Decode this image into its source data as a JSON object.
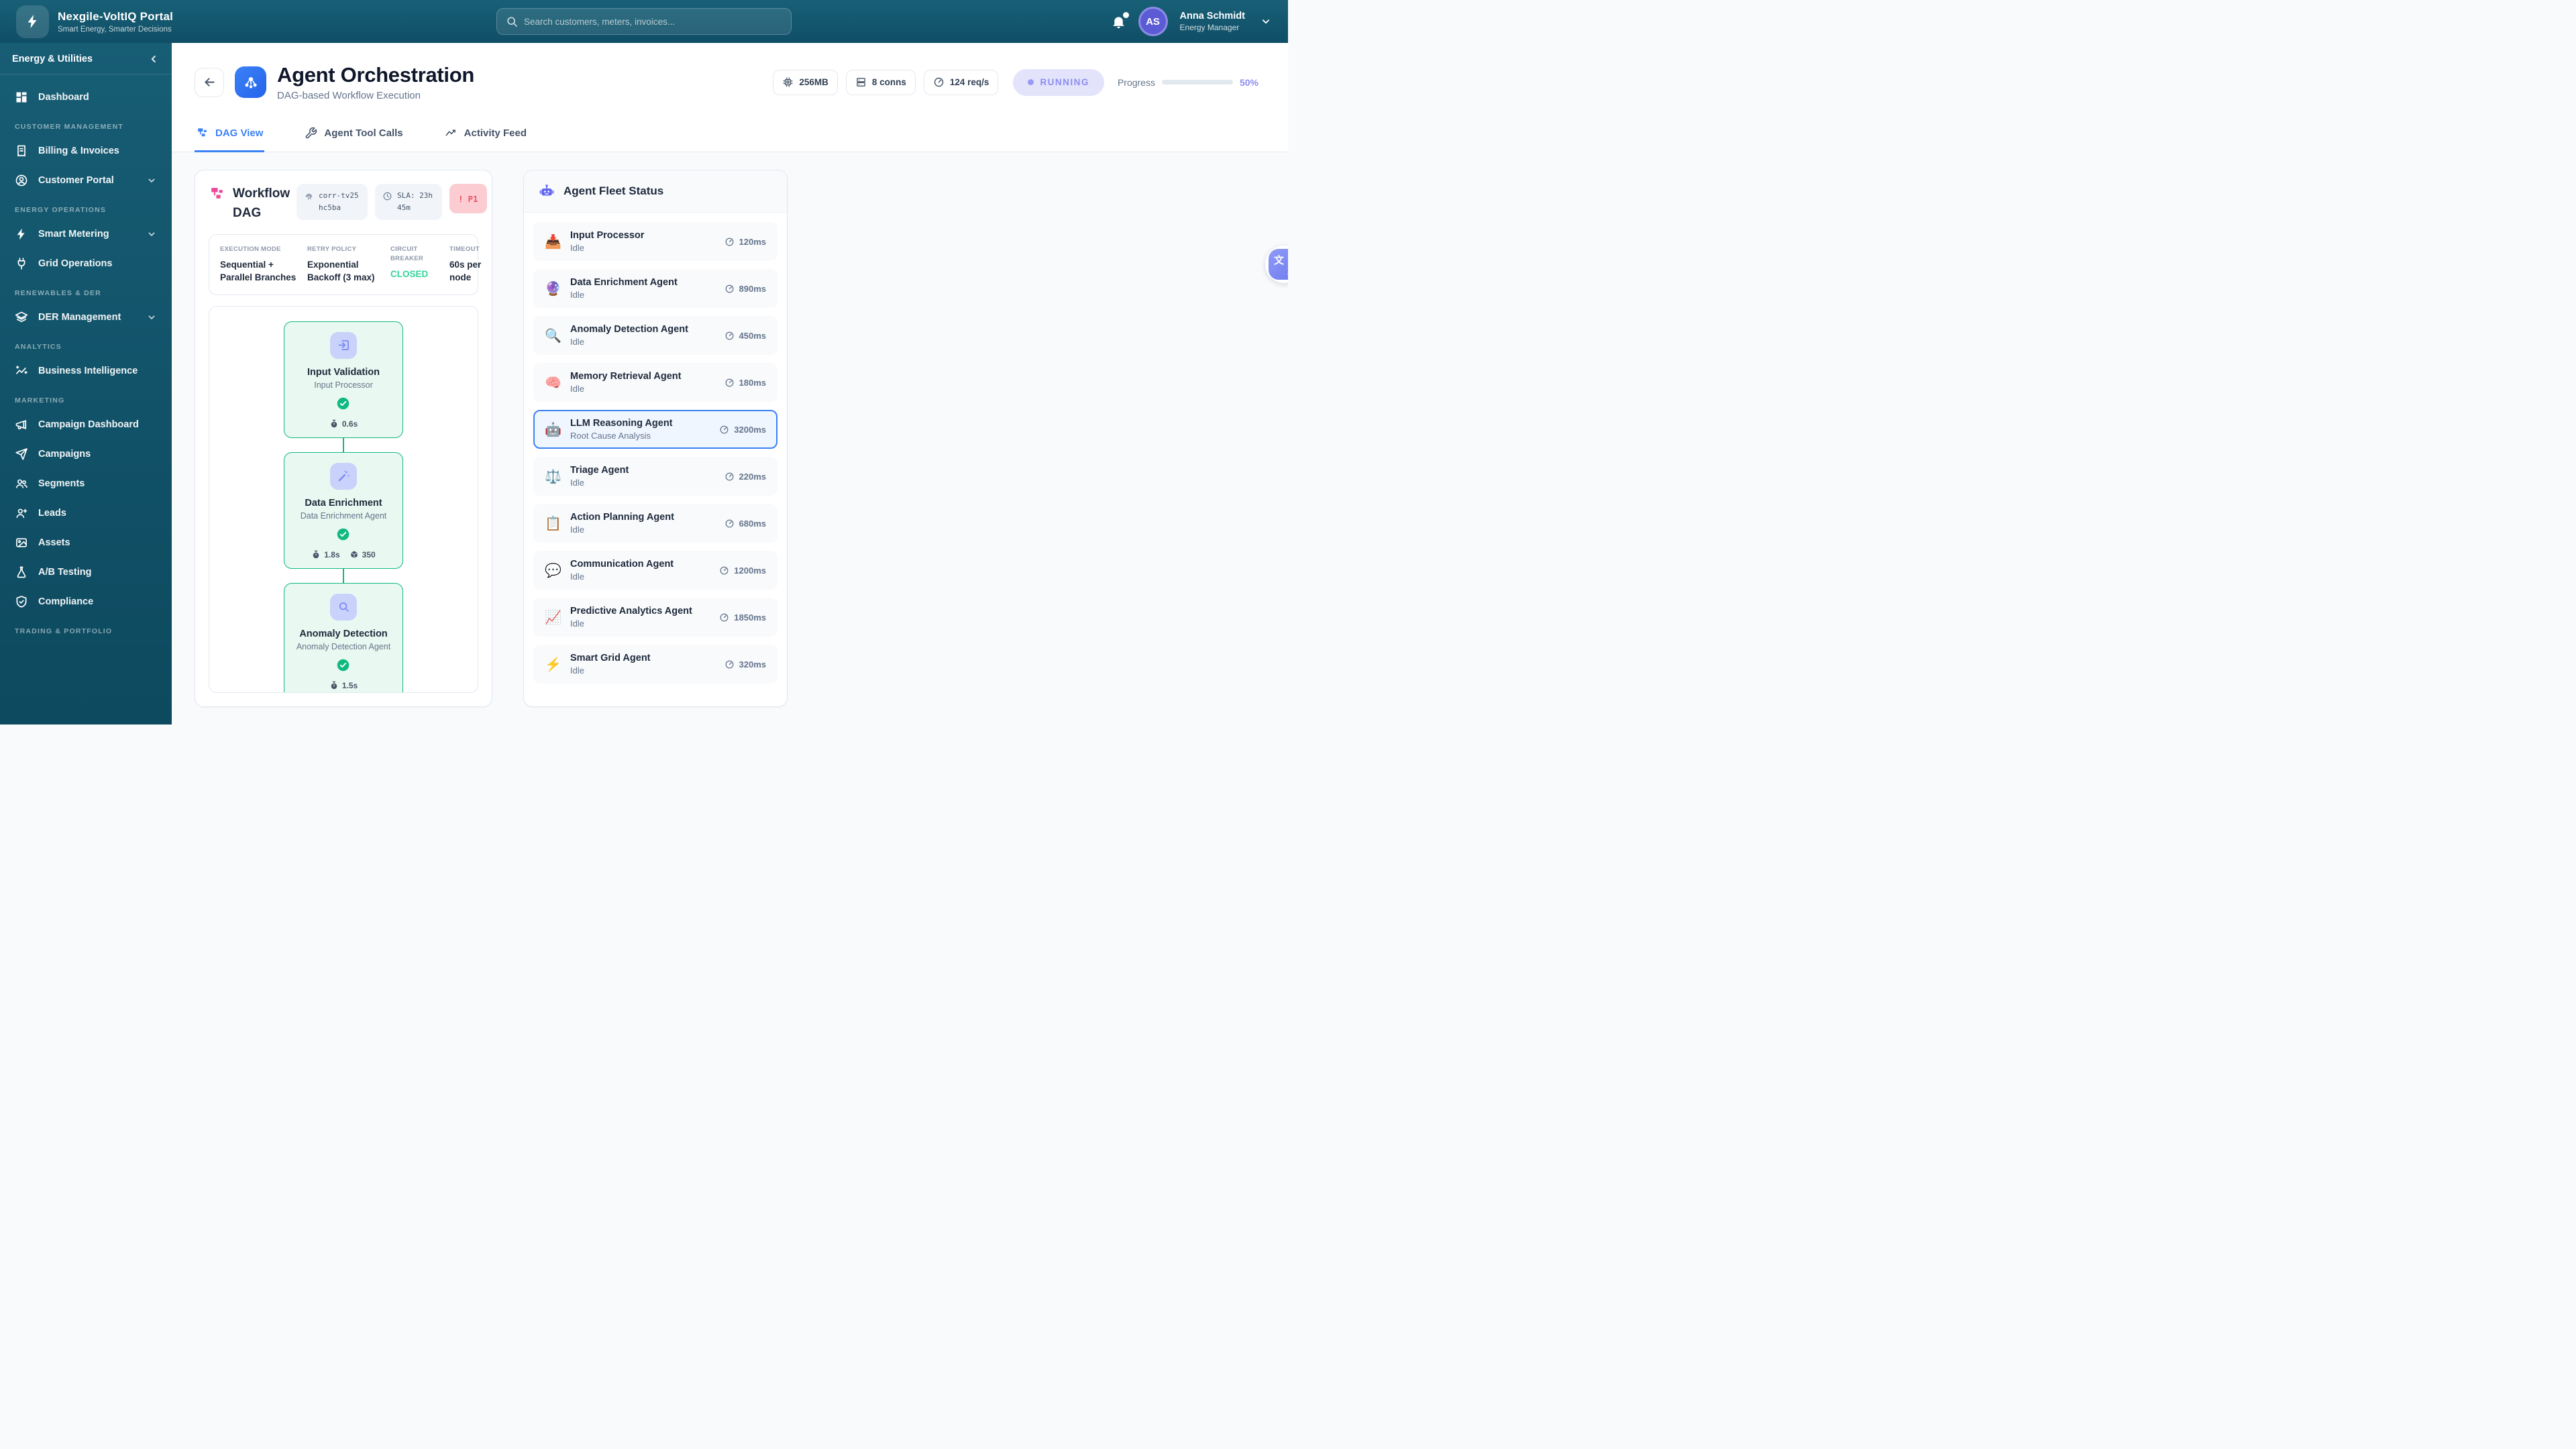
{
  "header": {
    "app_title": "Nexgile-VoltIQ Portal",
    "app_subtitle": "Smart Energy, Smarter Decisions",
    "search_placeholder": "Search customers, meters, invoices...",
    "user_initials": "AS",
    "user_name": "Anna Schmidt",
    "user_role": "Energy Manager"
  },
  "sidebar": {
    "context_label": "Energy & Utilities",
    "sections": [
      {
        "label": "",
        "items": [
          {
            "label": "Dashboard",
            "icon": "grid-icon"
          }
        ]
      },
      {
        "label": "CUSTOMER MANAGEMENT",
        "items": [
          {
            "label": "Billing & Invoices",
            "icon": "receipt-icon"
          },
          {
            "label": "Customer Portal",
            "icon": "person-circle-icon",
            "expandable": true
          }
        ]
      },
      {
        "label": "ENERGY OPERATIONS",
        "items": [
          {
            "label": "Smart Metering",
            "icon": "bolt-icon",
            "expandable": true
          },
          {
            "label": "Grid Operations",
            "icon": "plug-icon"
          }
        ]
      },
      {
        "label": "RENEWABLES & DER",
        "items": [
          {
            "label": "DER Management",
            "icon": "layers-icon",
            "expandable": true
          }
        ]
      },
      {
        "label": "ANALYTICS",
        "items": [
          {
            "label": "Business Intelligence",
            "icon": "sparkline-icon"
          }
        ]
      },
      {
        "label": "MARKETING",
        "items": [
          {
            "label": "Campaign Dashboard",
            "icon": "megaphone-icon"
          },
          {
            "label": "Campaigns",
            "icon": "send-icon"
          },
          {
            "label": "Segments",
            "icon": "people-icon"
          },
          {
            "label": "Leads",
            "icon": "person-add-icon"
          },
          {
            "label": "Assets",
            "icon": "image-icon"
          },
          {
            "label": "A/B Testing",
            "icon": "flask-icon"
          },
          {
            "label": "Compliance",
            "icon": "shield-check-icon"
          }
        ]
      },
      {
        "label": "TRADING & PORTFOLIO",
        "items": []
      }
    ]
  },
  "page": {
    "title": "Agent Orchestration",
    "subtitle": "DAG-based Workflow Execution",
    "stats": [
      {
        "icon": "cpu-icon",
        "label": "256MB"
      },
      {
        "icon": "server-icon",
        "label": "8 conns"
      },
      {
        "icon": "gauge-icon",
        "label": "124 req/s"
      }
    ],
    "status_label": "RUNNING",
    "progress_label": "Progress",
    "progress_value": 50,
    "progress_pct": "50%"
  },
  "tabs": [
    {
      "label": "DAG View",
      "icon": "dag-icon",
      "active": true
    },
    {
      "label": "Agent Tool Calls",
      "icon": "wrench-icon",
      "active": false
    },
    {
      "label": "Activity Feed",
      "icon": "activity-icon",
      "active": false
    }
  ],
  "workflow": {
    "title": "Workflow DAG",
    "correlation_id": "corr-tv25hc5ba",
    "sla": "SLA: 23h 45m",
    "priority": "P1",
    "priority_bang": "!",
    "exec": [
      {
        "label": "EXECUTION MODE",
        "value": "Sequential + Parallel Branches",
        "highlight": false
      },
      {
        "label": "RETRY POLICY",
        "value": "Exponential Backoff (3 max)",
        "highlight": false
      },
      {
        "label": "CIRCUIT BREAKER",
        "value": "CLOSED",
        "highlight": true
      },
      {
        "label": "TIMEOUT",
        "value": "60s per node",
        "highlight": false
      }
    ],
    "nodes": [
      {
        "title": "Input Validation",
        "subtitle": "Input Processor",
        "icon": "enter-icon",
        "duration": "0.6s",
        "tokens": ""
      },
      {
        "title": "Data Enrichment",
        "subtitle": "Data Enrichment Agent",
        "icon": "wand-icon",
        "duration": "1.8s",
        "tokens": "350"
      },
      {
        "title": "Anomaly Detection",
        "subtitle": "Anomaly Detection Agent",
        "icon": "search-icon",
        "duration": "1.5s",
        "tokens": ""
      }
    ],
    "branch_nodes": [
      {
        "icon": "cpu-icon"
      },
      {
        "icon": "circle-icon"
      }
    ]
  },
  "fleet": {
    "title": "Agent Fleet Status",
    "agents": [
      {
        "emoji": "📥",
        "name": "Input Processor",
        "status": "Idle",
        "latency": "120ms",
        "active": false
      },
      {
        "emoji": "🔮",
        "name": "Data Enrichment Agent",
        "status": "Idle",
        "latency": "890ms",
        "active": false
      },
      {
        "emoji": "🔍",
        "name": "Anomaly Detection Agent",
        "status": "Idle",
        "latency": "450ms",
        "active": false
      },
      {
        "emoji": "🧠",
        "name": "Memory Retrieval Agent",
        "status": "Idle",
        "latency": "180ms",
        "active": false
      },
      {
        "emoji": "🤖",
        "name": "LLM Reasoning Agent",
        "status": "Root Cause Analysis",
        "latency": "3200ms",
        "active": true
      },
      {
        "emoji": "⚖️",
        "name": "Triage Agent",
        "status": "Idle",
        "latency": "220ms",
        "active": false
      },
      {
        "emoji": "📋",
        "name": "Action Planning Agent",
        "status": "Idle",
        "latency": "680ms",
        "active": false
      },
      {
        "emoji": "💬",
        "name": "Communication Agent",
        "status": "Idle",
        "latency": "1200ms",
        "active": false
      },
      {
        "emoji": "📈",
        "name": "Predictive Analytics Agent",
        "status": "Idle",
        "latency": "1850ms",
        "active": false
      },
      {
        "emoji": "⚡",
        "name": "Smart Grid Agent",
        "status": "Idle",
        "latency": "320ms",
        "active": false
      }
    ]
  },
  "colors": {
    "accent_blue": "#3b82f6",
    "node_green": "#10b981",
    "running_purple": "#8d8ef1",
    "priority_red": "#ef4444",
    "closed_green": "#34d399",
    "dag_pink": "#ec4899"
  }
}
